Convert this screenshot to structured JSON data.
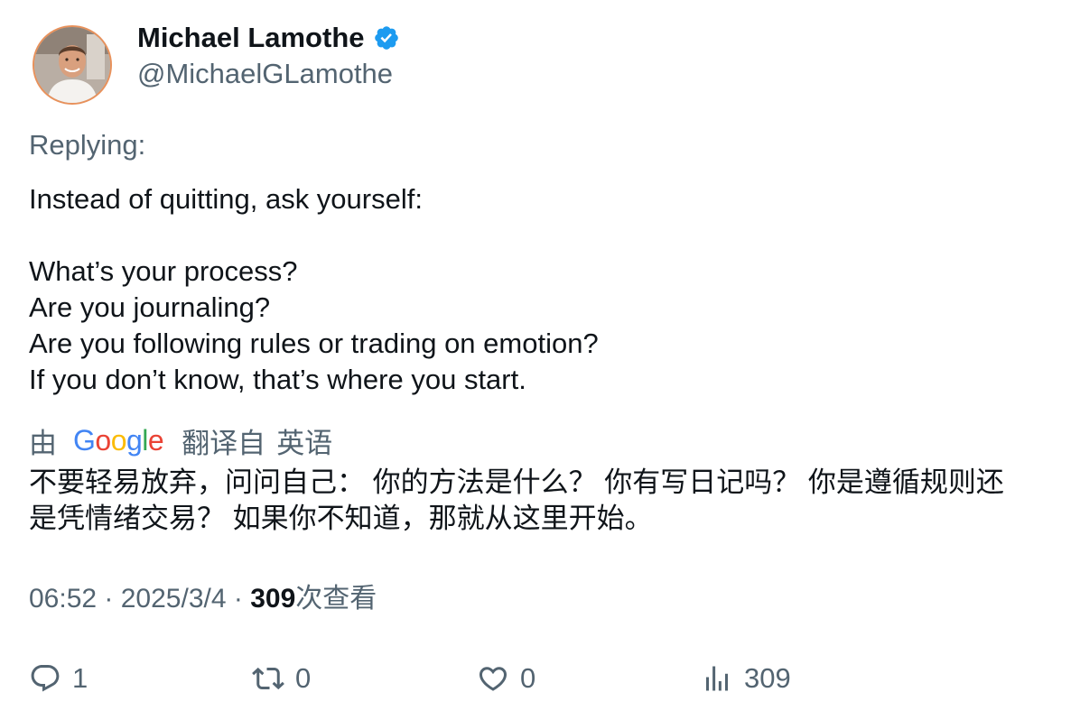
{
  "author": {
    "display_name": "Michael Lamothe",
    "handle": "@MichaelGLamothe",
    "verified": true,
    "verified_color": "#1d9bf0"
  },
  "tweet": {
    "replying_label": "Replying:",
    "lines": [
      "Instead of quitting, ask yourself:",
      "",
      "What’s your process?",
      "Are you journaling?",
      "Are you following rules or trading on emotion?",
      "If you don’t know, that’s where you start."
    ]
  },
  "translation": {
    "by_label": "由",
    "provider_letters": [
      "G",
      "o",
      "o",
      "g",
      "l",
      "e"
    ],
    "provider_colors": [
      "#4285F4",
      "#EA4335",
      "#FBBC05",
      "#4285F4",
      "#34A853",
      "#EA4335"
    ],
    "from_label": "翻译自",
    "language": "英语",
    "lines": [
      "不要轻易放弃，问问自己： 你的方法是什么？ 你有写日记吗？ 你是遵循规则还",
      "是凭情绪交易？ 如果你不知道，那就从这里开始。"
    ]
  },
  "meta": {
    "time": "06:52",
    "separator": " · ",
    "date": "2025/3/4",
    "views_count": "309",
    "views_label": "次查看"
  },
  "actions": {
    "replies": {
      "icon": "reply-icon",
      "count": "1"
    },
    "retweets": {
      "icon": "retweet-icon",
      "count": "0"
    },
    "likes": {
      "icon": "heart-icon",
      "count": "0"
    },
    "views": {
      "icon": "analytics-icon",
      "count": "309"
    }
  },
  "colors": {
    "text_primary": "#0f1419",
    "text_secondary": "#536471",
    "avatar_ring": "#e8915b"
  }
}
